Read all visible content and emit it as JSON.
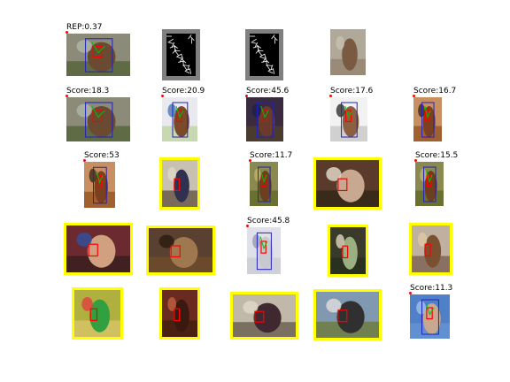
{
  "colors": {
    "background": "#ffffff",
    "detection_box": "#2020c0",
    "part_box": "#ff0000",
    "part_lines": "#00c000",
    "highlight_frame": "#ffff00",
    "text": "#000000"
  },
  "rows": [
    [
      {
        "label": "REP:0.37",
        "scene": "horse-outdoor",
        "framed": false,
        "box": true,
        "parts": true
      },
      {
        "label": "",
        "scene": "hog-gray",
        "framed": false,
        "box": false,
        "parts": false
      },
      {
        "label": "",
        "scene": "hog-gray",
        "framed": false,
        "box": false,
        "parts": false
      },
      {
        "label": "",
        "scene": "blur-horse",
        "framed": false,
        "box": false,
        "parts": false
      },
      {
        "label": "",
        "scene": "empty",
        "framed": false,
        "box": false,
        "parts": false
      }
    ],
    [
      {
        "label": "Score:18.3",
        "scene": "horse-outdoor",
        "framed": false,
        "box": true,
        "parts": true
      },
      {
        "label": "Score:20.9",
        "scene": "horse-painting",
        "framed": false,
        "box": true,
        "parts": true
      },
      {
        "label": "Score:45.6",
        "scene": "horse-dark",
        "framed": false,
        "box": true,
        "parts": true
      },
      {
        "label": "Score:17.6",
        "scene": "horse-sketch",
        "framed": false,
        "box": true,
        "parts": true
      },
      {
        "label": "Score:16.7",
        "scene": "horse-brown",
        "framed": false,
        "box": true,
        "parts": true
      }
    ],
    [
      {
        "label": "Score:53",
        "scene": "horse-brown",
        "framed": false,
        "box": true,
        "parts": true
      },
      {
        "label": "",
        "scene": "people-indoor",
        "framed": true,
        "box": false,
        "parts": true
      },
      {
        "label": "Score:11.7",
        "scene": "horse-field",
        "framed": false,
        "box": true,
        "parts": true
      },
      {
        "label": "",
        "scene": "dinner",
        "framed": true,
        "box": false,
        "parts": true
      },
      {
        "label": "Score:15.5",
        "scene": "horse-field",
        "framed": false,
        "box": true,
        "parts": true
      }
    ],
    [
      {
        "label": "",
        "scene": "group-faces",
        "framed": true,
        "box": false,
        "parts": true
      },
      {
        "label": "",
        "scene": "dog",
        "framed": true,
        "box": false,
        "parts": true
      },
      {
        "label": "Score:45.8",
        "scene": "horse-white",
        "framed": false,
        "box": true,
        "parts": true
      },
      {
        "label": "",
        "scene": "plant",
        "framed": true,
        "box": false,
        "parts": true
      },
      {
        "label": "",
        "scene": "statues",
        "framed": true,
        "box": false,
        "parts": true
      }
    ],
    [
      {
        "label": "",
        "scene": "parrot",
        "framed": true,
        "box": false,
        "parts": true
      },
      {
        "label": "",
        "scene": "interior",
        "framed": true,
        "box": false,
        "parts": true
      },
      {
        "label": "",
        "scene": "group-photo",
        "framed": true,
        "box": false,
        "parts": true
      },
      {
        "label": "",
        "scene": "car-outdoor",
        "framed": true,
        "box": false,
        "parts": true
      },
      {
        "label": "Score:11.3",
        "scene": "sky-horse",
        "framed": false,
        "box": true,
        "parts": true
      }
    ]
  ]
}
